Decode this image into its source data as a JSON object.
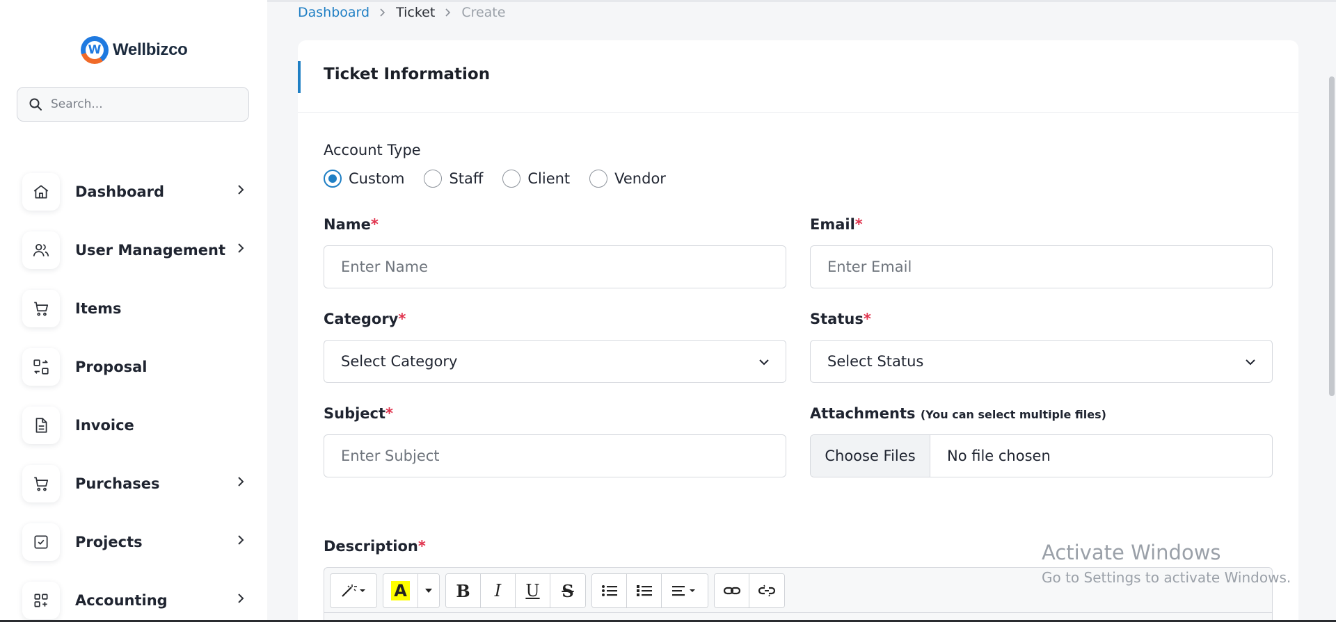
{
  "brand": {
    "name": "Wellbizco",
    "logo_letter": "W"
  },
  "search": {
    "placeholder": "Search..."
  },
  "sidebar": {
    "items": [
      {
        "label": "Dashboard",
        "icon": "home-icon",
        "has_submenu": true
      },
      {
        "label": "User Management",
        "icon": "users-icon",
        "has_submenu": true
      },
      {
        "label": "Items",
        "icon": "cart-icon",
        "has_submenu": false
      },
      {
        "label": "Proposal",
        "icon": "swap-icon",
        "has_submenu": false
      },
      {
        "label": "Invoice",
        "icon": "document-icon",
        "has_submenu": false
      },
      {
        "label": "Purchases",
        "icon": "cart-icon",
        "has_submenu": true
      },
      {
        "label": "Projects",
        "icon": "checkbox-icon",
        "has_submenu": true
      },
      {
        "label": "Accounting",
        "icon": "grid-plus-icon",
        "has_submenu": true
      }
    ]
  },
  "breadcrumb": {
    "root": "Dashboard",
    "parent": "Ticket",
    "current": "Create"
  },
  "card": {
    "title": "Ticket Information"
  },
  "form": {
    "account_type": {
      "label": "Account Type",
      "options": [
        "Custom",
        "Staff",
        "Client",
        "Vendor"
      ],
      "selected": "Custom"
    },
    "name": {
      "label": "Name",
      "required_mark": "*",
      "placeholder": "Enter Name"
    },
    "email": {
      "label": "Email",
      "required_mark": "*",
      "placeholder": "Enter Email"
    },
    "category": {
      "label": "Category",
      "required_mark": "*",
      "selected": "Select Category"
    },
    "status": {
      "label": "Status",
      "required_mark": "*",
      "selected": "Select Status"
    },
    "subject": {
      "label": "Subject",
      "required_mark": "*",
      "placeholder": "Enter Subject"
    },
    "attachments": {
      "label": "Attachments",
      "hint": "(You can select multiple files)",
      "button": "Choose Files",
      "status": "No file chosen"
    },
    "description": {
      "label": "Description",
      "required_mark": "*",
      "toolbar": {
        "highlight_glyph": "A",
        "bold": "B",
        "italic": "I",
        "underline": "U",
        "strike": "S"
      }
    }
  },
  "colors": {
    "accent": "#1f7fc4",
    "required": "#e0334d",
    "highlight": "#ffff00"
  },
  "watermark": {
    "line1": "Activate Windows",
    "line2": "Go to Settings to activate Windows."
  }
}
